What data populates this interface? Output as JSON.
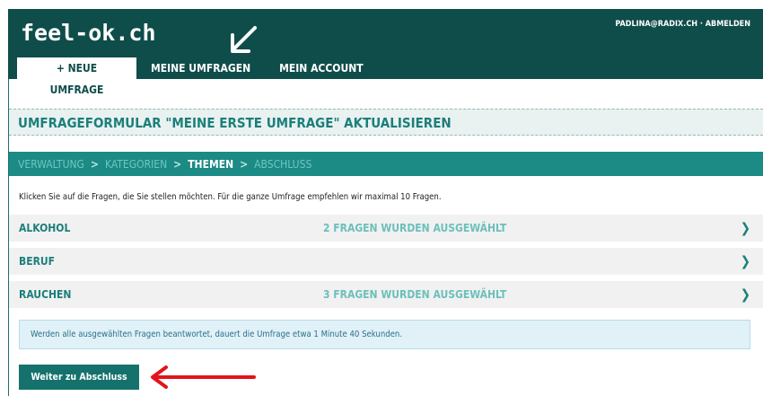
{
  "header": {
    "logo": "feel-ok.ch",
    "user_link": "PADLINA@RADIX.CH · ABMELDEN",
    "tabs": [
      {
        "label": "+ NEUE UMFRAGE"
      },
      {
        "label": "MEINE UMFRAGEN"
      },
      {
        "label": "MEIN ACCOUNT"
      }
    ]
  },
  "page": {
    "title": "UMFRAGEFORMULAR \"MEINE ERSTE UMFRAGE\" AKTUALISIEREN"
  },
  "breadcrumb": {
    "items": [
      "VERWALTUNG",
      "KATEGORIEN",
      "THEMEN",
      "ABSCHLUSS"
    ],
    "separator": ">"
  },
  "intro": "Klicken Sie auf die Fragen, die Sie stellen möchten. Für die ganze Umfrage empfehlen wir maximal 10 Fragen.",
  "topics": [
    {
      "name": "ALKOHOL",
      "status": "2 FRAGEN WURDEN AUSGEWÄHLT"
    },
    {
      "name": "BERUF",
      "status": ""
    },
    {
      "name": "RAUCHEN",
      "status": "3 FRAGEN WURDEN AUSGEWÄHLT"
    }
  ],
  "info": "Werden alle ausgewählten Fragen beantwortet, dauert die Umfrage etwa 1 Minute 40 Sekunden.",
  "button_label": "Weiter zu Abschluss",
  "colors": {
    "header_bg": "#0f4d4a",
    "accent": "#1c8a85",
    "annotation_arrow_red": "#e3141b"
  },
  "icons": [
    "chevron-right-icon",
    "annotation-arrow-icon"
  ]
}
